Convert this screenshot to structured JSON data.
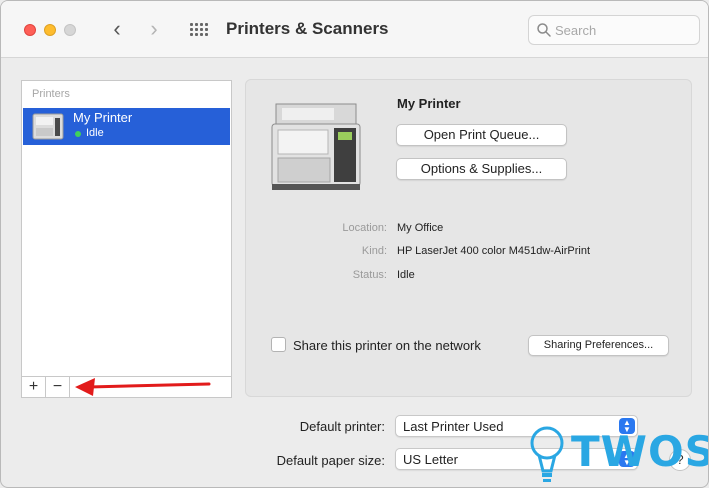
{
  "window": {
    "title": "Printers & Scanners",
    "colors": {
      "close": "#fe5f57",
      "minimize": "#febc2e",
      "selection": "#2660d8",
      "accent": "#2a78f0"
    }
  },
  "toolbar": {
    "back_icon": "chevron-left-icon",
    "forward_icon": "chevron-right-icon",
    "grid_icon": "grid-icon",
    "search_placeholder": "Search"
  },
  "printers_list": {
    "header": "Printers",
    "items": [
      {
        "name": "My Printer",
        "status": "Idle",
        "status_color": "#3fd05a",
        "selected": true
      }
    ],
    "add_label": "+",
    "remove_label": "−"
  },
  "detail": {
    "name": "My Printer",
    "open_queue_label": "Open Print Queue...",
    "options_label": "Options & Supplies...",
    "location_label": "Location:",
    "location_value": "My Office",
    "kind_label": "Kind:",
    "kind_value": "HP LaserJet 400 color M451dw-AirPrint",
    "status_label": "Status:",
    "status_value": "Idle",
    "share_label": "Share this printer on the network",
    "share_checked": false,
    "sharing_prefs_label": "Sharing Preferences..."
  },
  "defaults": {
    "printer_label": "Default printer:",
    "printer_value": "Last Printer Used",
    "paper_label": "Default paper size:",
    "paper_value": "US Letter",
    "help_label": "?"
  },
  "watermark": {
    "text": "TWOS"
  }
}
